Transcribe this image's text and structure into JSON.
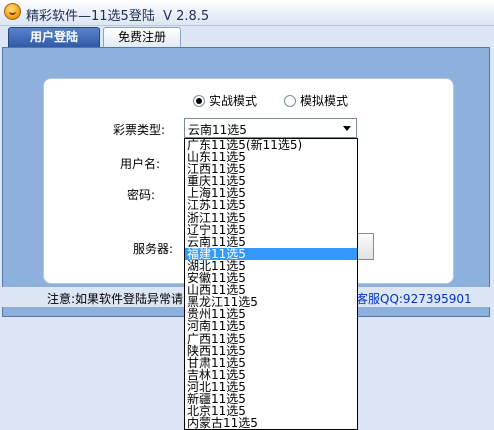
{
  "window": {
    "title": "精彩软件—11选5登陆",
    "version": "V 2.8.5"
  },
  "tabs": [
    {
      "label": "用户登陆",
      "active": true
    },
    {
      "label": "免费注册",
      "active": false
    }
  ],
  "mode": {
    "real_label": "实战模式",
    "sim_label": "模拟模式",
    "selected": "real"
  },
  "form": {
    "lottery_type_label": "彩票类型:",
    "lottery_type_value": "云南11选5",
    "username_label": "用户名:",
    "password_label": "密码:",
    "server_label": "服务器:"
  },
  "notice": {
    "left_text": "注意:如果软件登陆异常请",
    "right_text": "客服QQ:927395901"
  },
  "dropdown": {
    "selected_index": 9,
    "options": [
      "广东11选5(新11选5)",
      "山东11选5",
      "江西11选5",
      "重庆11选5",
      "上海11选5",
      "江苏11选5",
      "浙江11选5",
      "辽宁11选5",
      "云南11选5",
      "福建11选5",
      "湖北11选5",
      "安徽11选5",
      "山西11选5",
      "黑龙江11选5",
      "贵州11选5",
      "河南11选5",
      "广西11选5",
      "陕西11选5",
      "甘肃11选5",
      "吉林11选5",
      "河北11选5",
      "新疆11选5",
      "北京11选5",
      "内蒙古11选5"
    ]
  },
  "colors": {
    "active_tab": "#2f5ba8",
    "panel": "#8db0dd",
    "highlight": "#3399ff",
    "link": "#0033cc"
  }
}
